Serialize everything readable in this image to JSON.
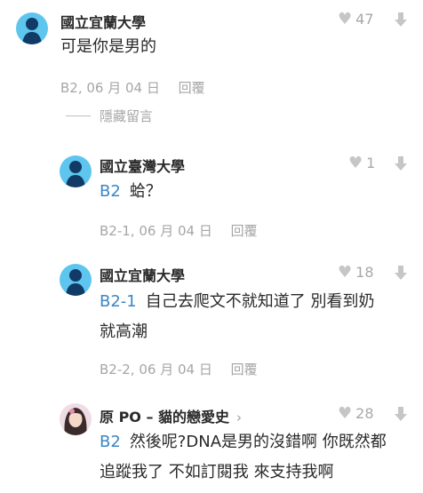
{
  "comments": [
    {
      "author": "國立宜蘭大學",
      "likes": "47",
      "text": "可是你是男的",
      "floor": "B2",
      "date": "06 月 04 日",
      "reply": "回覆",
      "hidden": "隱藏留言"
    },
    {
      "author": "國立臺灣大學",
      "likes": "1",
      "tag": "B2",
      "text": "蛤？",
      "floor": "B2-1",
      "date": "06 月 04 日",
      "reply": "回覆"
    },
    {
      "author": "國立宜蘭大學",
      "likes": "18",
      "tag": "B2-1",
      "text_line1": "自己去爬文不就知道了 別看到奶",
      "text_line2": "就高潮",
      "floor": "B2-2",
      "date": "06 月 04 日",
      "reply": "回覆"
    },
    {
      "author": "原 PO – 貓的戀愛史",
      "chevron": "›",
      "likes": "28",
      "tag": "B2",
      "text_line1": "然後呢?DNA是男的沒錯啊 你既然都",
      "text_line2": "追蹤我了 不如訂閱我 來支持我啊"
    }
  ],
  "colors": {
    "accent": "#3b86c4",
    "avatar": "#5ec6ee",
    "muted": "#a6a6a6"
  },
  "icons": [
    "user-avatar-icon",
    "heart-icon",
    "dislike-arrow-icon"
  ]
}
